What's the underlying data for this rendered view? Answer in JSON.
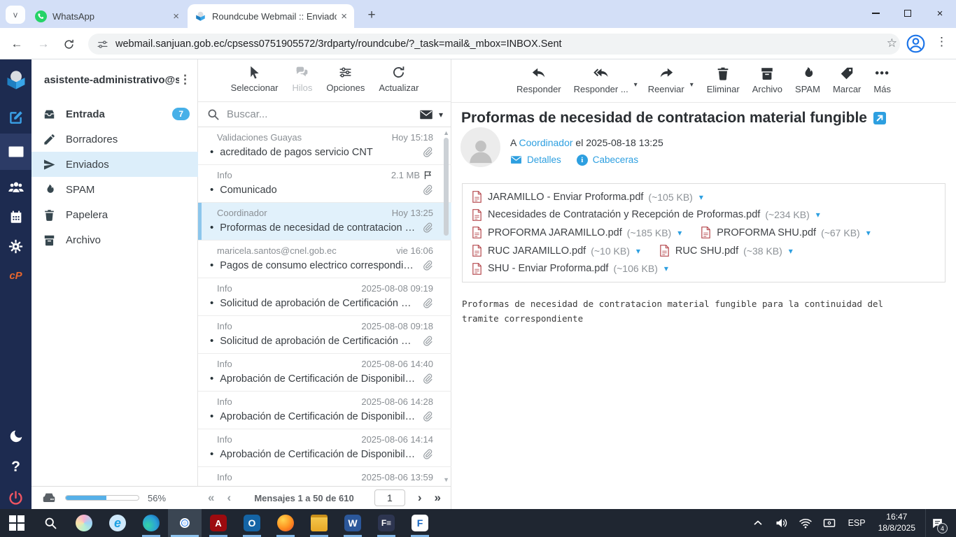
{
  "browser": {
    "tabs": [
      {
        "label": "WhatsApp"
      },
      {
        "label": "Roundcube Webmail :: Enviados"
      }
    ],
    "url": "webmail.sanjuan.gob.ec/cpsess0751905572/3rdparty/roundcube/?_task=mail&_mbox=INBOX.Sent"
  },
  "sidebar": {
    "account": "asistente-administrativo@sa...",
    "folders": [
      {
        "label": "Entrada",
        "badge": "7"
      },
      {
        "label": "Borradores"
      },
      {
        "label": "Enviados"
      },
      {
        "label": "SPAM"
      },
      {
        "label": "Papelera"
      },
      {
        "label": "Archivo"
      }
    ],
    "storage": {
      "percent": "56%"
    }
  },
  "list": {
    "toolbar": {
      "select": "Seleccionar",
      "threads": "Hilos",
      "options": "Opciones",
      "refresh": "Actualizar"
    },
    "search_placeholder": "Buscar...",
    "messages": [
      {
        "sender": "Validaciones Guayas",
        "meta": "Hoy 15:18",
        "subject": "acreditado de pagos servicio CNT"
      },
      {
        "sender": "Info",
        "meta": "2.1 MB",
        "subject": "Comunicado"
      },
      {
        "sender": "Coordinador",
        "meta": "Hoy 13:25",
        "subject": "Proformas de necesidad de contratacion m..."
      },
      {
        "sender": "maricela.santos@cnel.gob.ec",
        "meta": "vie 16:06",
        "subject": "Pagos de consumo electrico correspondien..."
      },
      {
        "sender": "Info",
        "meta": "2025-08-08 09:19",
        "subject": "Solicitud de aprobación de Certificación Pre..."
      },
      {
        "sender": "Info",
        "meta": "2025-08-08 09:18",
        "subject": "Solicitud de aprobación de Certificación Pre..."
      },
      {
        "sender": "Info",
        "meta": "2025-08-06 14:40",
        "subject": "Aprobación de Certificación de Disponibilid..."
      },
      {
        "sender": "Info",
        "meta": "2025-08-06 14:28",
        "subject": "Aprobación de Certificación de Disponibilid..."
      },
      {
        "sender": "Info",
        "meta": "2025-08-06 14:14",
        "subject": "Aprobación de Certificación de Disponibilid..."
      },
      {
        "sender": "Info",
        "meta": "2025-08-06 13:59",
        "subject": ""
      }
    ],
    "pagination": {
      "text": "Mensajes 1 a 50 de 610",
      "page": "1"
    }
  },
  "mail": {
    "toolbar": {
      "reply": "Responder",
      "reply_all": "Responder ...",
      "forward": "Reenviar",
      "delete": "Eliminar",
      "archive": "Archivo",
      "spam": "SPAM",
      "mark": "Marcar",
      "more": "Más"
    },
    "subject": "Proformas de necesidad de contratacion material fungible",
    "from_prefix": "A",
    "from_to": "Coordinador",
    "from_rest": "el 2025-08-18 13:25",
    "links": {
      "details": "Detalles",
      "headers": "Cabeceras"
    },
    "attachments": [
      {
        "name": "JARAMILLO - Enviar Proforma.pdf",
        "size": "(~105 KB)"
      },
      {
        "name": "Necesidades de Contratación y Recepción de Proformas.pdf",
        "size": "(~234 KB)"
      },
      {
        "name": "PROFORMA JARAMILLO.pdf",
        "size": "(~185 KB)"
      },
      {
        "name": "PROFORMA SHU.pdf",
        "size": "(~67 KB)"
      },
      {
        "name": "RUC JARAMILLO.pdf",
        "size": "(~10 KB)"
      },
      {
        "name": "RUC SHU.pdf",
        "size": "(~38 KB)"
      },
      {
        "name": "SHU - Enviar Proforma.pdf",
        "size": "(~106 KB)"
      }
    ],
    "body": "Proformas de necesidad de contratacion material fungible para la continuidad del tramite correspondiente"
  },
  "taskbar": {
    "tray": {
      "language": "ESP",
      "time": "16:47",
      "date": "18/8/2025",
      "notifications": "4"
    }
  },
  "colors": {
    "accent": "#2d9fe0",
    "rail": "#1d2b50",
    "badge": "#47b0e8",
    "selection": "#e1f1fb"
  }
}
